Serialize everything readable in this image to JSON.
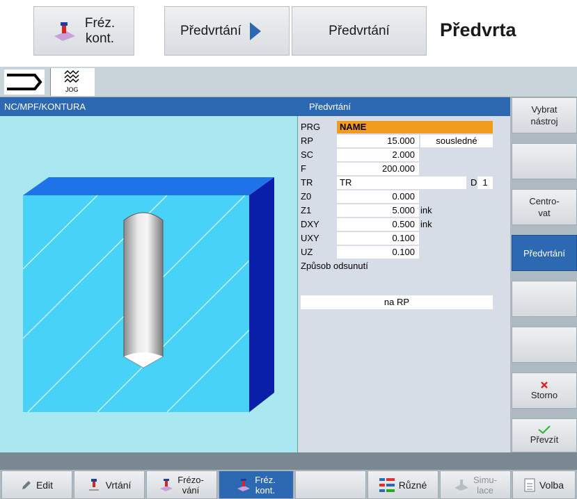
{
  "breadcrumb": {
    "item1": {
      "line1": "Fréz.",
      "line2": "kont."
    },
    "item2": "Předvrtání",
    "item3": "Předvrtání",
    "title": "Předvrta"
  },
  "topbar": {
    "jog_label": "JOG"
  },
  "titlebar": {
    "left": "NC/MPF/KONTURA",
    "right": "Předvrtání"
  },
  "form": {
    "prg": {
      "label": "PRG",
      "value": "NAME"
    },
    "rp": {
      "label": "RP",
      "value": "15.000",
      "option": "sousledné"
    },
    "sc": {
      "label": "SC",
      "value": "2.000"
    },
    "f": {
      "label": "F",
      "value": "200.000"
    },
    "tr": {
      "label": "TR",
      "value": "TR",
      "d_label": "D",
      "d_value": "1"
    },
    "z0": {
      "label": "Z0",
      "value": "0.000"
    },
    "z1": {
      "label": "Z1",
      "value": "5.000",
      "unit": "ink"
    },
    "dxy": {
      "label": "DXY",
      "value": "0.500",
      "unit": "ink"
    },
    "uxy": {
      "label": "UXY",
      "value": "0.100"
    },
    "uz": {
      "label": "UZ",
      "value": "0.100"
    },
    "retract": {
      "label": "Způsob odsunutí",
      "value": "na RP"
    }
  },
  "softkeys": {
    "vybrat": {
      "line1": "Vybrat",
      "line2": "nástroj"
    },
    "centrovat": {
      "line1": "Centro-",
      "line2": "vat"
    },
    "predvrtani": "Předvrtání",
    "storno": "Storno",
    "prevzit": "Převzít"
  },
  "hkeys": {
    "edit": "Edit",
    "vrtani": "Vrtání",
    "frezovani": {
      "line1": "Frézo-",
      "line2": "vání"
    },
    "frezkont": {
      "line1": "Fréz.",
      "line2": "kont."
    },
    "ruzne": "Různé",
    "simulace": {
      "line1": "Simu-",
      "line2": "lace"
    },
    "volba": "Volba"
  },
  "colors": {
    "accent": "#2d69b3",
    "highlight": "#f29b1c",
    "view_bg": "#a9e7f1",
    "block_top": "#1e73e8",
    "block_side": "#0a1fa8",
    "block_front": "#48d2f7"
  }
}
